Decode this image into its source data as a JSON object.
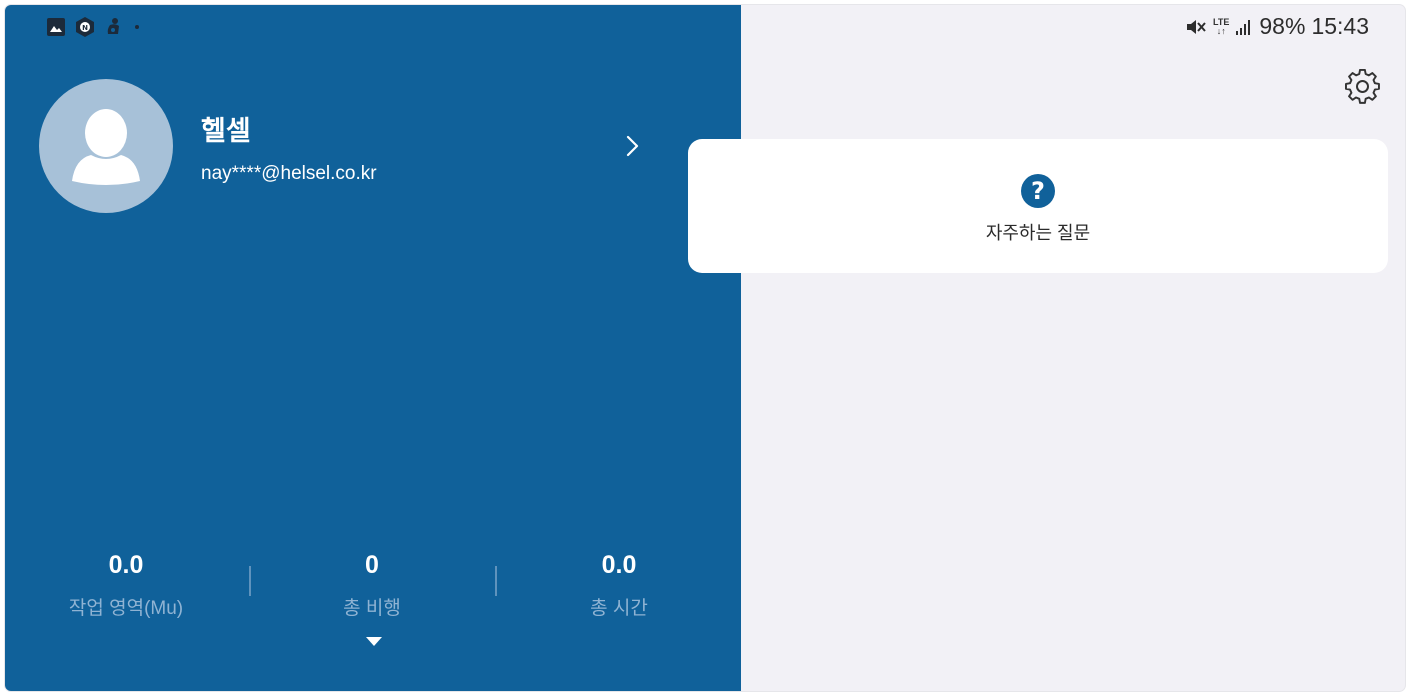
{
  "status_bar": {
    "battery": "98%",
    "time": "15:43",
    "network_top": "LTE",
    "network_bottom": "↓↑",
    "left_icons": [
      "gallery-icon",
      "naver-icon",
      "app-icon",
      "dot-icon"
    ],
    "right_icons": [
      "mute-icon",
      "lte-icon",
      "signal-icon"
    ]
  },
  "profile": {
    "name": "헬셀",
    "email": "nay****@helsel.co.kr",
    "avatar_icon": "person-icon",
    "chevron_icon": "chevron-right-icon"
  },
  "stats": [
    {
      "value": "0.0",
      "label": "작업 영역(Mu)"
    },
    {
      "value": "0",
      "label": "총 비행"
    },
    {
      "value": "0.0",
      "label": "총 시간"
    }
  ],
  "expand_icon": "caret-down-icon",
  "settings_icon": "gear-icon",
  "faq": {
    "label": "자주하는 질문",
    "icon": "question-circle-icon"
  },
  "colors": {
    "panel_blue": "#10619a",
    "avatar_bg": "#a7c1d8",
    "stat_label": "#8fb3d3",
    "right_bg": "#f2f1f6",
    "card_bg": "#ffffff"
  }
}
